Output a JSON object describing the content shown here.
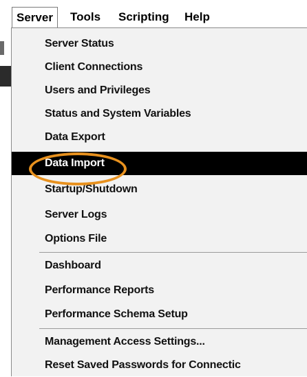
{
  "menubar": {
    "items": [
      {
        "label": "Server"
      },
      {
        "label": "Tools"
      },
      {
        "label": "Scripting"
      },
      {
        "label": "Help"
      }
    ]
  },
  "server_menu": {
    "items": [
      {
        "label": "Server Status"
      },
      {
        "label": "Client Connections"
      },
      {
        "label": "Users and Privileges"
      },
      {
        "label": "Status and System Variables"
      },
      {
        "label": "Data Export"
      },
      {
        "label": "Data Import"
      },
      {
        "label": "Startup/Shutdown"
      },
      {
        "label": "Server Logs"
      },
      {
        "label": "Options File"
      },
      {
        "label": "Dashboard"
      },
      {
        "label": "Performance Reports"
      },
      {
        "label": "Performance Schema Setup"
      },
      {
        "label": "Management Access Settings..."
      },
      {
        "label": "Reset Saved Passwords for Connectic"
      }
    ],
    "highlighted_item": "Data Import"
  },
  "colors": {
    "highlight_bg": "#000000",
    "highlight_text": "#ffffff",
    "annotation": "#e8911e",
    "menu_bg": "#f2f2f2"
  }
}
